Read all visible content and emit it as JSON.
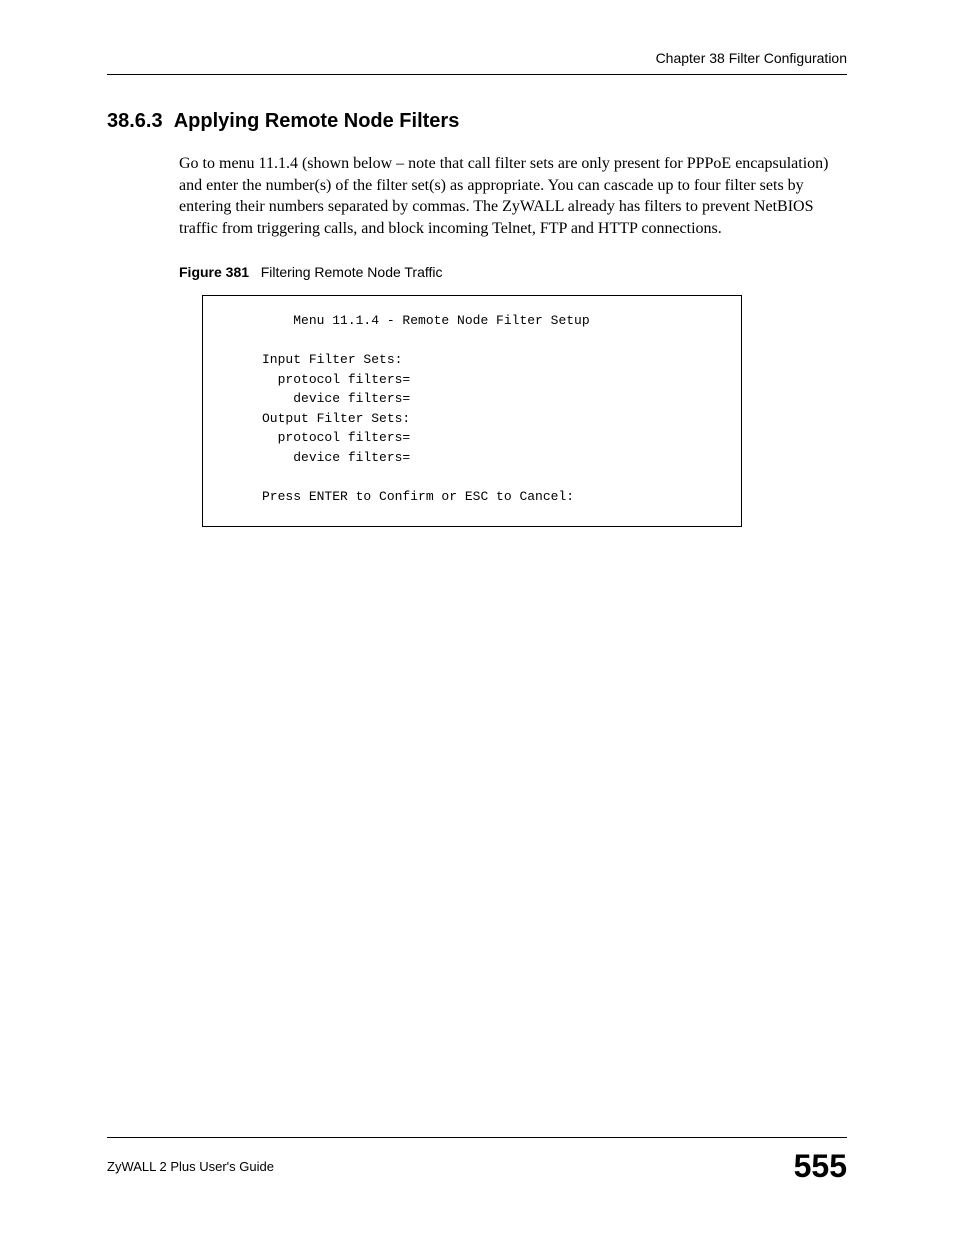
{
  "header": {
    "chapter": "Chapter 38 Filter Configuration"
  },
  "section": {
    "number": "38.6.3",
    "title": "Applying Remote Node Filters"
  },
  "paragraph": "Go to menu 11.1.4 (shown below – note that call filter sets are only present for PPPoE encapsulation) and enter the number(s) of the filter set(s) as appropriate. You can cascade up to four filter sets by entering their numbers separated by commas. The ZyWALL already has filters to prevent NetBIOS traffic from triggering calls, and block incoming Telnet, FTP and HTTP connections.",
  "figure": {
    "label": "Figure 381",
    "caption": "Filtering Remote Node Traffic"
  },
  "codebox": {
    "line1": "         Menu 11.1.4 - Remote Node Filter Setup",
    "line2": "",
    "line3": "     Input Filter Sets:",
    "line4": "       protocol filters=",
    "line5": "         device filters=",
    "line6": "     Output Filter Sets:",
    "line7": "       protocol filters=",
    "line8": "         device filters=",
    "line9": "",
    "line10": "     Press ENTER to Confirm or ESC to Cancel:"
  },
  "footer": {
    "guide": "ZyWALL 2 Plus User's Guide",
    "page": "555"
  }
}
